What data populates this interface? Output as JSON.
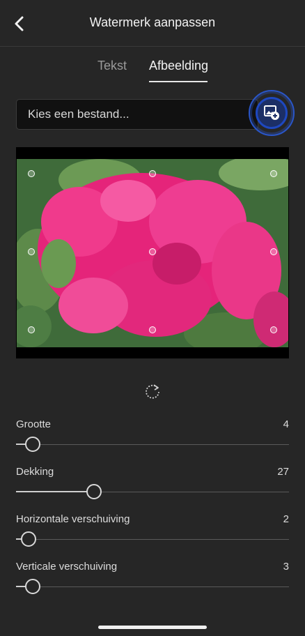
{
  "header": {
    "title": "Watermerk aanpassen",
    "back_icon": "chevron-left-icon"
  },
  "tabs": [
    {
      "label": "Tekst",
      "selected": false
    },
    {
      "label": "Afbeelding",
      "selected": true
    }
  ],
  "file": {
    "placeholder": "Kies een bestand...",
    "add_icon": "add-image-icon",
    "accent": "#1e48c0"
  },
  "preview": {
    "image": "pink bougainvillea flowers photo",
    "rotate_icon": "rotate-icon"
  },
  "sliders": [
    {
      "label": "Grootte",
      "value": "4",
      "fraction": 0.06
    },
    {
      "label": "Dekking",
      "value": "27",
      "fraction": 0.285
    },
    {
      "label": "Horizontale verschuiving",
      "value": "2",
      "fraction": 0.045
    },
    {
      "label": "Verticale verschuiving",
      "value": "3",
      "fraction": 0.06
    }
  ]
}
